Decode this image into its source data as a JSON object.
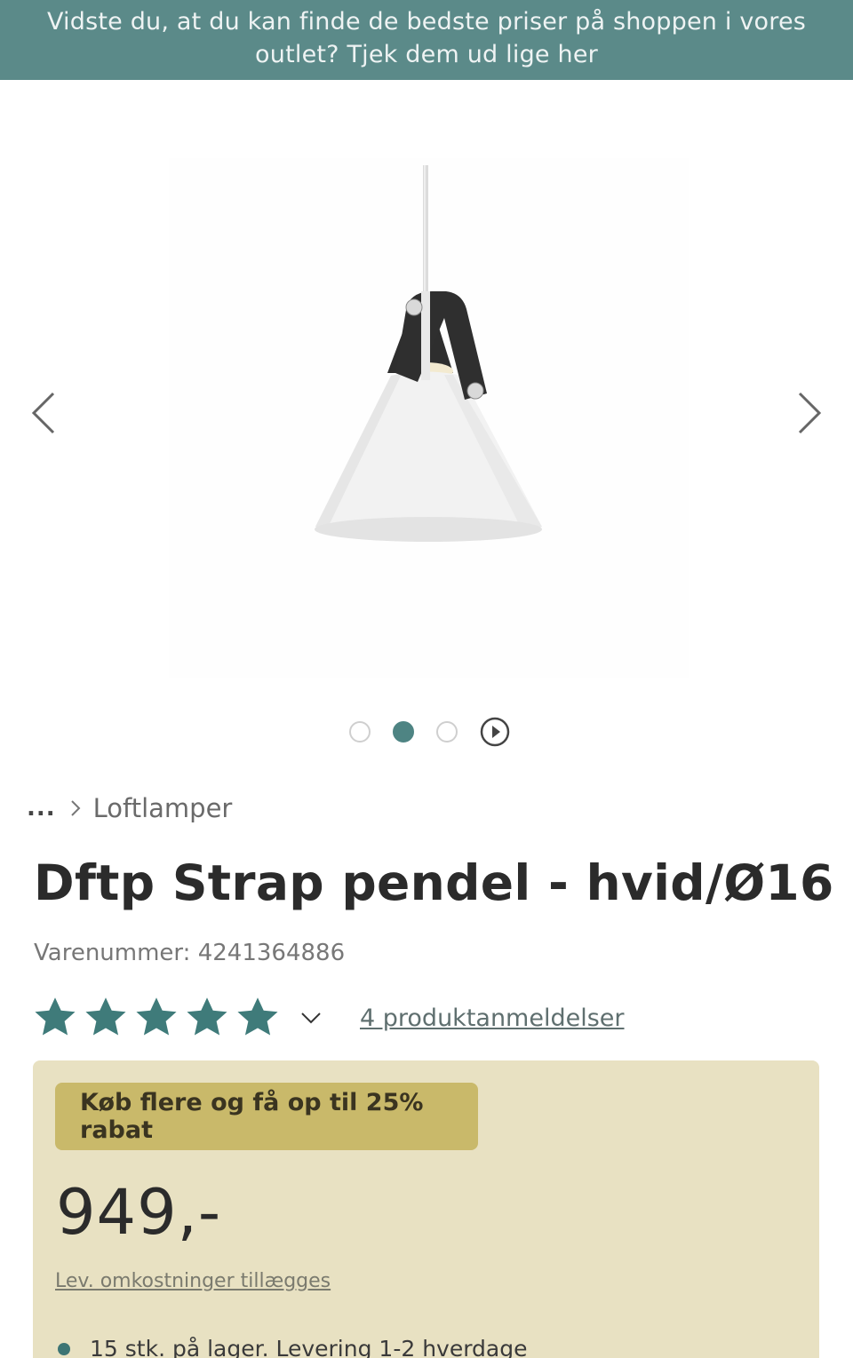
{
  "banner": {
    "line1": "Vidste du, at du kan finde de bedste priser på shoppen i vores",
    "line2": "outlet? Tjek dem ud lige her"
  },
  "gallery": {
    "image_icon": "pendant-lamp-image",
    "prev_icon": "chevron-left-icon",
    "next_icon": "chevron-right-icon",
    "slides": 3,
    "active_slide": 2,
    "play_icon": "play-icon"
  },
  "breadcrumb": {
    "ellipsis": "...",
    "current": "Loftlamper"
  },
  "product": {
    "title": "Dftp Strap pendel - hvid/Ø16",
    "sku_label": "Varenummer:",
    "sku": "4241364886",
    "rating_value": 5,
    "rating_max": 5,
    "reviews_link": "4 produktanmeldelser"
  },
  "pricing": {
    "promo": "Køb flere og få op til 25% rabat",
    "price": "949,-",
    "shipping_note": "Lev. omkostninger tillægges",
    "stock": "15 stk. på lager. Levering 1-2 hverdage"
  },
  "colors": {
    "banner_bg": "#5b8a89",
    "accent": "#4e8483",
    "price_box_bg": "#e8e1c2",
    "promo_bg": "#c9b96a"
  }
}
